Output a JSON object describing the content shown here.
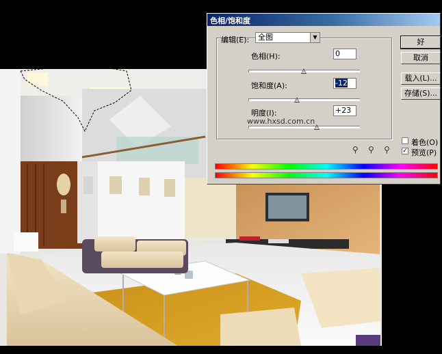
{
  "dialog": {
    "title": "色相/饱和度",
    "edit_label": "编辑(E):",
    "edit_value": "全图",
    "hue_label": "色相(H):",
    "hue_value": "0",
    "saturation_label": "饱和度(A):",
    "saturation_value": "-12",
    "lightness_label": "明度(I):",
    "lightness_value": "+23",
    "watermark": "www.hxsd.com.cn",
    "ok_label": "好",
    "cancel_label": "取消",
    "load_label": "载入(L)...",
    "save_label": "存储(S)...",
    "colorize_label": "着色(O)",
    "colorize_checked": false,
    "preview_label": "预览(P)",
    "preview_checked": true,
    "hue_level": 0.5,
    "saturation_level": 0.44,
    "lightness_level": 0.62,
    "icons": [
      "eyedropper-icon",
      "eyedropper-plus-icon",
      "eyedropper-minus-icon"
    ]
  }
}
